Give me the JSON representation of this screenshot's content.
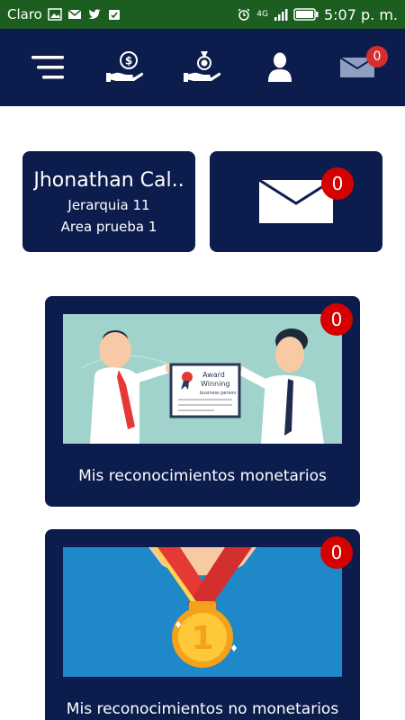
{
  "status_bar": {
    "carrier": "Claro",
    "network": "4G",
    "time": "5:07 p. m."
  },
  "nav": {
    "items": [
      {
        "name": "menu-icon"
      },
      {
        "name": "money-hand-icon"
      },
      {
        "name": "medal-hand-icon"
      },
      {
        "name": "user-icon"
      },
      {
        "name": "mail-icon",
        "badge": "0"
      }
    ]
  },
  "profile": {
    "name": "Jhonathan Cal..",
    "jerarquia": "Jerarquia 11",
    "area": "Area prueba 1"
  },
  "messages": {
    "badge": "0"
  },
  "cards": [
    {
      "label": "Mis reconocimientos monetarios",
      "badge": "0",
      "image_text_title": "Award\nWinning",
      "image_text_sub": "business person"
    },
    {
      "label": "Mis reconocimientos no monetarios",
      "badge": "0",
      "medal_number": "1"
    }
  ],
  "colors": {
    "navy": "#0c1d4d",
    "status_green": "#1b5e20",
    "badge_red": "#d50000"
  }
}
